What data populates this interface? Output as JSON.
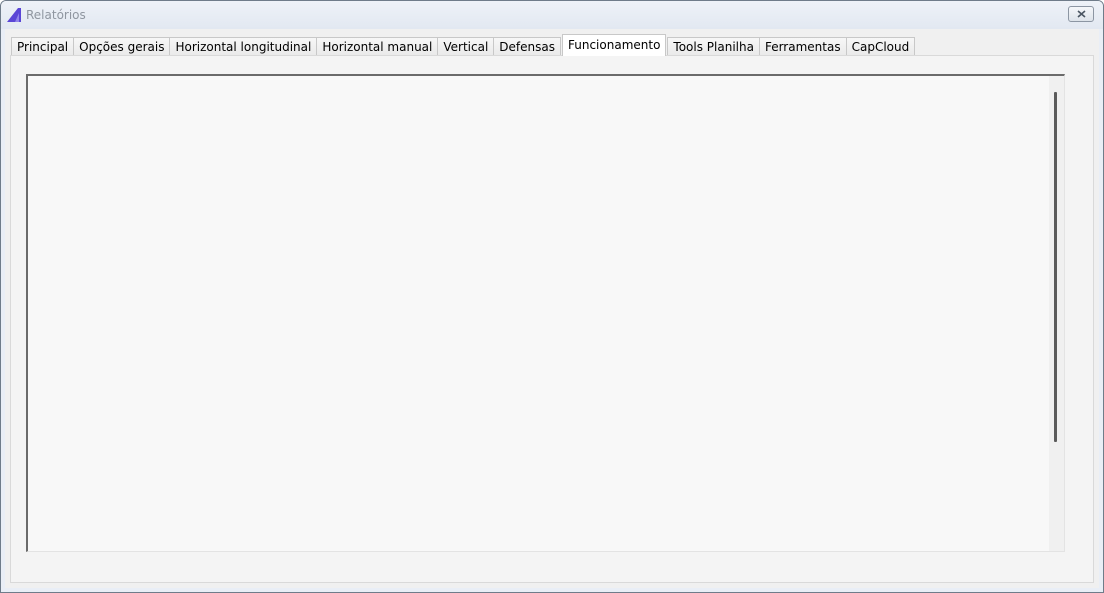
{
  "window": {
    "title": "Relatórios",
    "icon": "app-logo-icon",
    "close_icon": "close-icon"
  },
  "tabs": [
    {
      "label": "Principal",
      "active": false
    },
    {
      "label": "Opções gerais",
      "active": false
    },
    {
      "label": "Horizontal longitudinal",
      "active": false
    },
    {
      "label": "Horizontal manual",
      "active": false
    },
    {
      "label": "Vertical",
      "active": false
    },
    {
      "label": "Defensas",
      "active": false
    },
    {
      "label": "Funcionamento",
      "active": true
    },
    {
      "label": "Tools Planilha",
      "active": false
    },
    {
      "label": "Ferramentas",
      "active": false
    },
    {
      "label": "CapCloud",
      "active": false
    }
  ],
  "content": {
    "text": ""
  },
  "colors": {
    "app_logo": "#5a46d6",
    "title_text": "#8f96a0"
  }
}
